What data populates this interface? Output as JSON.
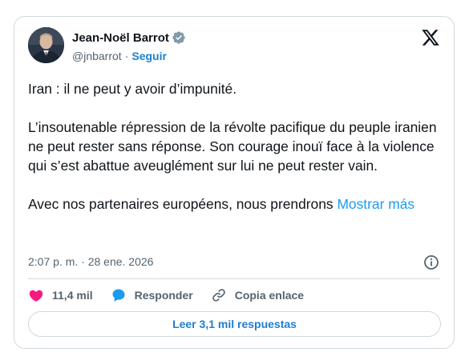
{
  "author": {
    "name": "Jean-Noël Barrot",
    "handle": "@jnbarrot",
    "separator": "·",
    "follow_label": "Seguir"
  },
  "tweet": {
    "paragraphs": [
      "Iran : il ne peut y avoir d’impunité.",
      "L’insoutenable répression de la révolte pacifique du peuple iranien ne peut rester sans réponse. Son courage inouï face à la violence qui s’est abattue aveuglément sur lui ne peut rester vain.",
      "Avec nos partenaires européens, nous prendrons"
    ],
    "show_more": "Mostrar más",
    "timestamp": "2:07 p. m. · 28 ene. 2026"
  },
  "actions": {
    "likes": "11,4 mil",
    "reply_label": "Responder",
    "copy_link_label": "Copia enlace"
  },
  "read_replies_label": "Leer 3,1 mil respuestas",
  "colors": {
    "accent": "#1d9bf0",
    "like": "#f91880",
    "border": "#cfd9de",
    "muted": "#536471"
  },
  "icons": [
    "verified-badge-icon",
    "x-logo-icon",
    "info-icon",
    "heart-icon",
    "speech-bubble-icon",
    "link-icon"
  ]
}
